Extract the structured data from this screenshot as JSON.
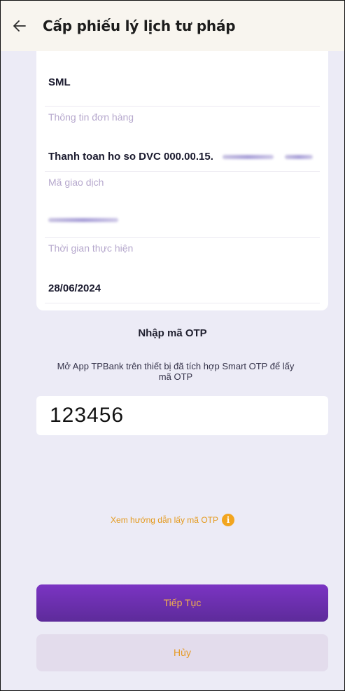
{
  "header": {
    "back_icon": "arrow-left-icon",
    "title": "Cấp phiếu lý lịch tư pháp"
  },
  "details": {
    "provider_value": "SML",
    "order_info_label": "Thông tin đơn hàng",
    "order_info_value": "Thanh toan ho so DVC 000.00.15.",
    "transaction_code_label": "Mã giao dịch",
    "time_label": "Thời gian thực hiện",
    "time_value": "28/06/2024"
  },
  "otp": {
    "title": "Nhập mã OTP",
    "description": "Mở App TPBank trên thiết bị đã tích hợp Smart OTP để lấy mã OTP",
    "input_value": "123456",
    "guide_link": "Xem hướng dẫn lấy mã OTP",
    "info_icon": "info-icon"
  },
  "buttons": {
    "continue_label": "Tiếp Tục",
    "cancel_label": "Hủy"
  },
  "colors": {
    "accent_purple": "#6a2fae",
    "accent_orange": "#f2a51f",
    "label_lilac": "#b6a8cd",
    "background": "#ecebf6"
  }
}
